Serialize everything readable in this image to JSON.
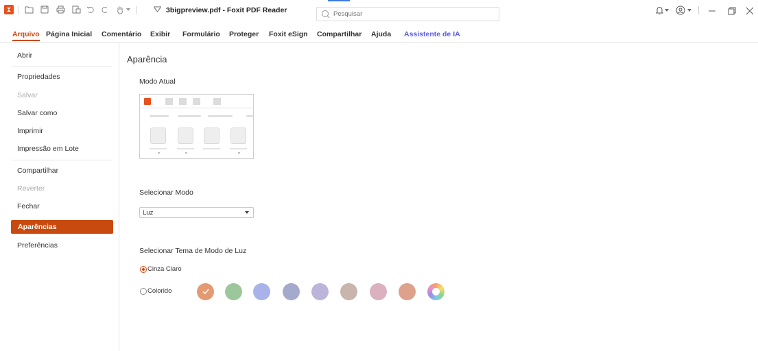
{
  "titlebar": {
    "title": "3bigpreview.pdf - Foxit PDF Reader",
    "search_placeholder": "Pesquisar",
    "icons": [
      "foxit-logo-icon",
      "open-folder-icon",
      "save-icon",
      "print-icon",
      "new-doc-icon",
      "undo-icon",
      "redo-icon",
      "hand-tool-icon",
      "dropdown-icon",
      "customize-icon",
      "bell-icon",
      "user-icon",
      "minimize-icon",
      "restore-icon",
      "close-icon"
    ]
  },
  "tabs": [
    {
      "label": "Arquivo"
    },
    {
      "label": "Página Inicial"
    },
    {
      "label": "Comentário"
    },
    {
      "label": "Exibir"
    },
    {
      "label": "Formulário"
    },
    {
      "label": "Proteger"
    },
    {
      "label": "Foxit eSign"
    },
    {
      "label": "Compartilhar"
    },
    {
      "label": "Ajuda"
    },
    {
      "label": "Assistente de IA"
    }
  ],
  "sidebar": {
    "items": [
      {
        "label": "Abrir"
      },
      {
        "label": "Propriedades"
      },
      {
        "label": "Salvar"
      },
      {
        "label": "Salvar como"
      },
      {
        "label": "Imprimir"
      },
      {
        "label": "Impressão em Lote"
      },
      {
        "label": "Compartilhar"
      },
      {
        "label": "Reverter"
      },
      {
        "label": "Fechar"
      },
      {
        "label": "Aparências"
      },
      {
        "label": "Preferências"
      }
    ]
  },
  "main": {
    "title": "Aparência",
    "current_mode_label": "Modo Atual",
    "select_mode_label": "Selecionar Modo",
    "select_mode_value": "Luz",
    "theme_label": "Selecionar Tema de Modo de Luz",
    "option_light_gray": "Cinza Claro",
    "option_colored": "Colorido",
    "swatch_colors": [
      "#e39a72",
      "#9cc79a",
      "#a9b3ea",
      "#a3aacb",
      "#bdb4dc",
      "#c9b5ac",
      "#dbb0bf",
      "#dda18c"
    ]
  },
  "colors": {
    "accent": "#c94a0e",
    "ai_tab": "#5b5be0",
    "logo": "#e8501c"
  }
}
